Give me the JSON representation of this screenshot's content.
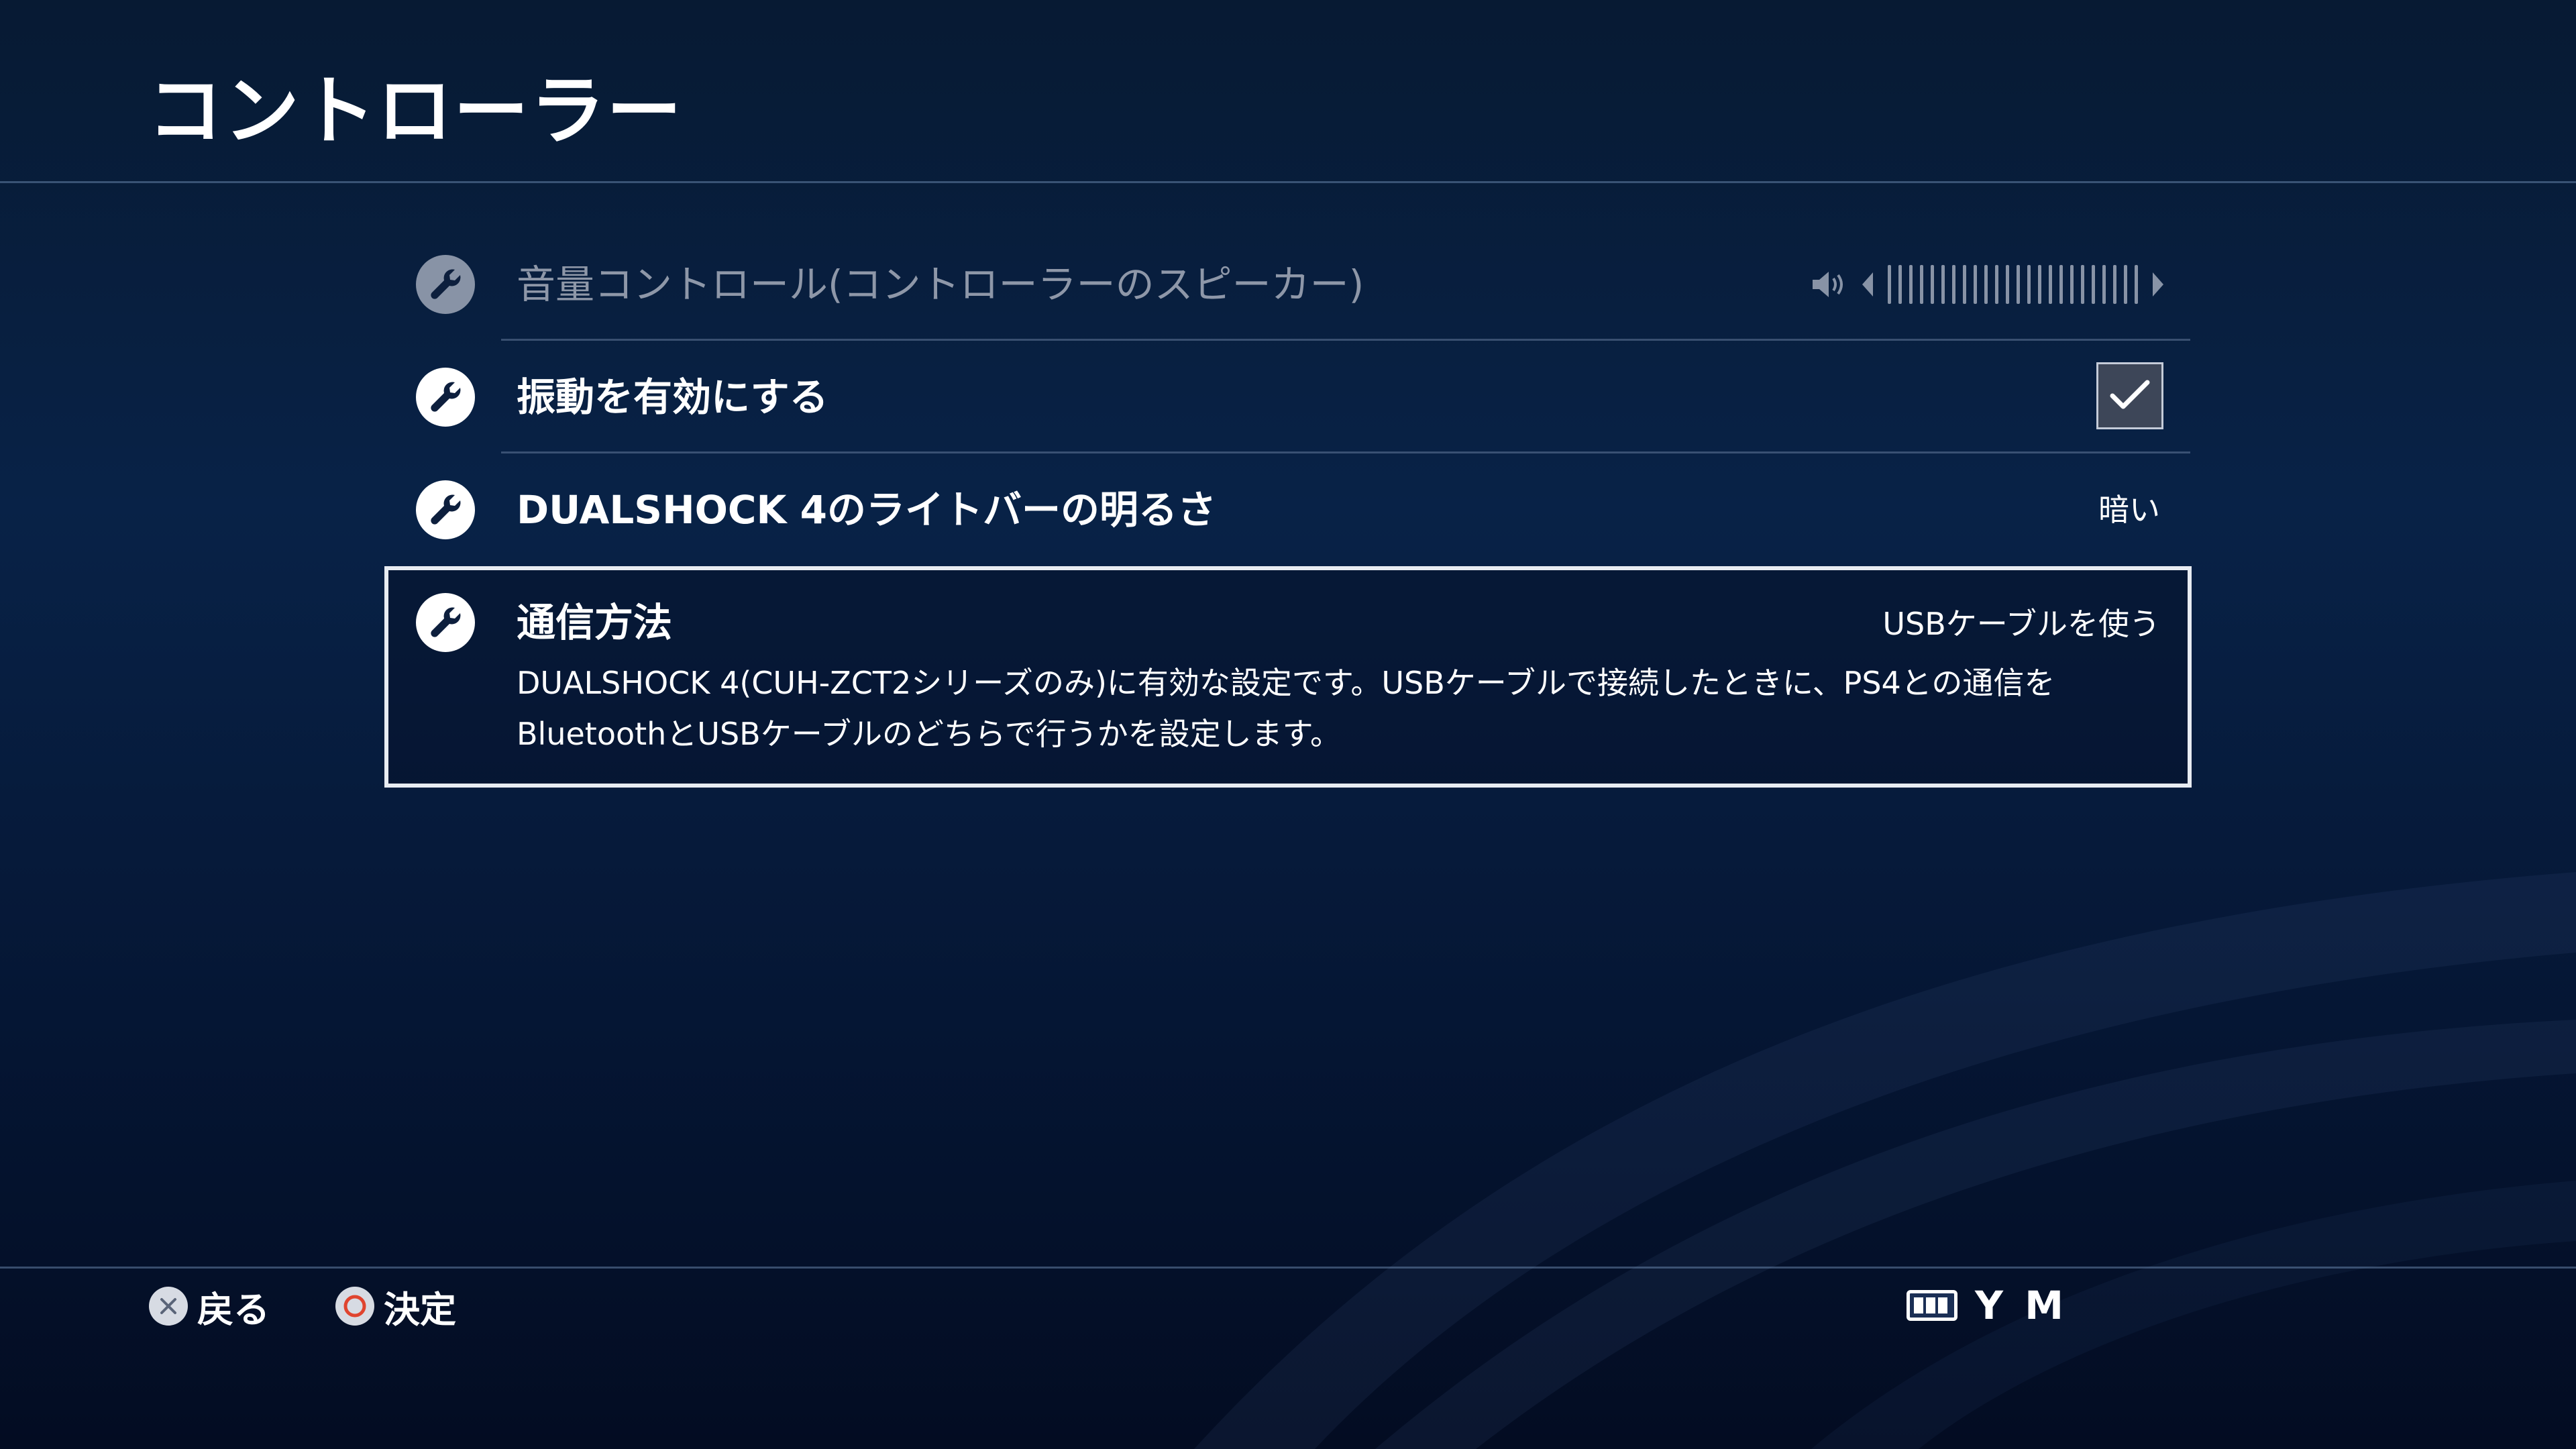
{
  "page": {
    "title": "コントローラー"
  },
  "settings": {
    "items": [
      {
        "label": "音量コントロール(コントローラーのスピーカー)",
        "type": "slider",
        "enabled": false,
        "icon": "wrench-icon",
        "volume_icon": "speaker-icon",
        "level": 1.0
      },
      {
        "label": "振動を有効にする",
        "type": "checkbox",
        "enabled": true,
        "checked": true,
        "icon": "wrench-icon"
      },
      {
        "label": "DUALSHOCK 4のライトバーの明るさ",
        "type": "select",
        "enabled": true,
        "value": "暗い",
        "icon": "wrench-icon"
      },
      {
        "label": "通信方法",
        "type": "select",
        "enabled": true,
        "selected": true,
        "value": "USBケーブルを使う",
        "description": "DUALSHOCK 4(CUH-ZCT2シリーズのみ)に有効な設定です。USBケーブルで接続したときに、PS4との通信をBluetoothとUSBケーブルのどちらで行うかを設定します。",
        "icon": "wrench-icon"
      }
    ]
  },
  "footer": {
    "back_label": "戻る",
    "back_icon": "cross-button-icon",
    "confirm_label": "決定",
    "confirm_icon": "circle-button-icon",
    "user_name": "Y M",
    "user_icon": "controller-battery-icon"
  },
  "colors": {
    "background": "#082247",
    "text": "#ffffff",
    "disabled_text": "#8e97a8",
    "circle_button": "#e0442f"
  }
}
